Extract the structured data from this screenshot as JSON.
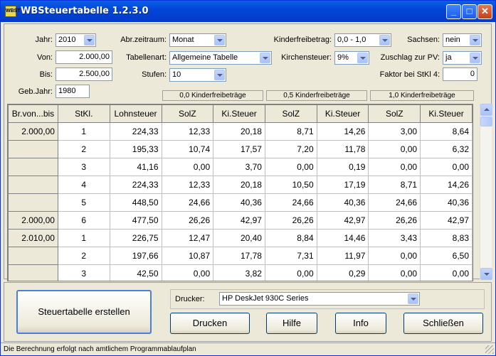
{
  "window": {
    "title": "WBSteuertabelle 1.2.3.0",
    "icon_text": "WBST"
  },
  "form": {
    "jahr_label": "Jahr:",
    "jahr_value": "2010",
    "von_label": "Von:",
    "von_value": "2.000,00",
    "bis_label": "Bis:",
    "bis_value": "2.500,00",
    "gebjahr_label": "Geb.Jahr:",
    "gebjahr_value": "1980",
    "abrzeitraum_label": "Abr.zeitraum:",
    "abrzeitraum_value": "Monat",
    "tabellenart_label": "Tabellenart:",
    "tabellenart_value": "Allgemeine Tabelle",
    "stufen_label": "Stufen:",
    "stufen_value": "10",
    "kinderfreibetrag_label": "Kinderfreibetrag:",
    "kinderfreibetrag_value": "0,0 - 1,0",
    "kirchensteuer_label": "Kirchensteuer:",
    "kirchensteuer_value": "9%",
    "sachsen_label": "Sachsen:",
    "sachsen_value": "nein",
    "zuschlag_label": "Zuschlag zur PV:",
    "zuschlag_value": "ja",
    "faktor_label": "Faktor bei StKl 4:",
    "faktor_value": "0"
  },
  "groups": [
    "0,0 Kinderfreibeträge",
    "0,5 Kinderfreibeträge",
    "1,0 Kinderfreibeträge"
  ],
  "table": {
    "headers": [
      "Br.von...bis",
      "StKl.",
      "Lohnsteuer",
      "SolZ",
      "Ki.Steuer",
      "SolZ",
      "Ki.Steuer",
      "SolZ",
      "Ki.Steuer"
    ],
    "rows": [
      [
        "2.000,00",
        "1",
        "224,33",
        "12,33",
        "20,18",
        "8,71",
        "14,26",
        "3,00",
        "8,64"
      ],
      [
        "",
        "2",
        "195,33",
        "10,74",
        "17,57",
        "7,20",
        "11,78",
        "0,00",
        "6,32"
      ],
      [
        "",
        "3",
        "41,16",
        "0,00",
        "3,70",
        "0,00",
        "0,19",
        "0,00",
        "0,00"
      ],
      [
        "",
        "4",
        "224,33",
        "12,33",
        "20,18",
        "10,50",
        "17,19",
        "8,71",
        "14,26"
      ],
      [
        "",
        "5",
        "448,50",
        "24,66",
        "40,36",
        "24,66",
        "40,36",
        "24,66",
        "40,36"
      ],
      [
        "2.000,00",
        "6",
        "477,50",
        "26,26",
        "42,97",
        "26,26",
        "42,97",
        "26,26",
        "42,97"
      ],
      [
        "2.010,00",
        "1",
        "226,75",
        "12,47",
        "20,40",
        "8,84",
        "14,46",
        "3,43",
        "8,83"
      ],
      [
        "",
        "2",
        "197,66",
        "10,87",
        "17,78",
        "7,31",
        "11,97",
        "0,00",
        "6,50"
      ],
      [
        "",
        "3",
        "42,50",
        "0,00",
        "3,82",
        "0,00",
        "0,29",
        "0,00",
        "0,00"
      ]
    ]
  },
  "bottom": {
    "create_button": "Steuertabelle erstellen",
    "drucker_label": "Drucker:",
    "drucker_value": "HP DeskJet 930C Series",
    "drucken_button": "Drucken",
    "hilfe_button": "Hilfe",
    "info_button": "Info",
    "schliessen_button": "Schließen"
  },
  "status": "Die Berechnung erfolgt nach amtlichem Programmablaufplan"
}
